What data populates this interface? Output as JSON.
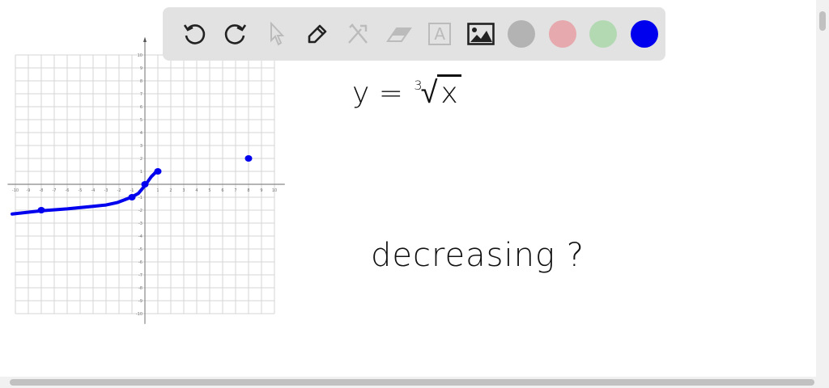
{
  "toolbar": {
    "tools": [
      {
        "name": "undo-icon",
        "enabled": true
      },
      {
        "name": "redo-icon",
        "enabled": true
      },
      {
        "name": "select-pointer-icon",
        "enabled": false
      },
      {
        "name": "pen-icon",
        "enabled": true
      },
      {
        "name": "tools-icon",
        "enabled": false
      },
      {
        "name": "eraser-icon",
        "enabled": false
      },
      {
        "name": "text-box-icon",
        "enabled": false
      },
      {
        "name": "image-icon",
        "enabled": true
      }
    ],
    "text_tool_glyph": "A",
    "colors": [
      "#b3b3b3",
      "#e6a9ad",
      "#b3d9b3",
      "#0000ee"
    ],
    "selected_color": "#0000ee"
  },
  "notes": {
    "equation_lhs": "y =",
    "equation_index": "3",
    "equation_radicand": "x",
    "question": "decreasing ?"
  },
  "chart_data": {
    "type": "line",
    "title": "",
    "xlim": [
      -10,
      10
    ],
    "ylim": [
      -10,
      10
    ],
    "grid": true,
    "x_ticks": [
      "-10",
      "-9",
      "-8",
      "-7",
      "-6",
      "-5",
      "-4",
      "-3",
      "-2",
      "-1",
      "1",
      "2",
      "3",
      "4",
      "5",
      "6",
      "7",
      "8",
      "9",
      "10"
    ],
    "y_ticks": [
      "10",
      "9",
      "8",
      "7",
      "6",
      "5",
      "4",
      "3",
      "2",
      "1",
      "-1",
      "-2",
      "-3",
      "-4",
      "-5",
      "-6",
      "-7",
      "-8",
      "-9",
      "-10"
    ],
    "series": [
      {
        "name": "hand-drawn curve",
        "color": "#0000ee",
        "x": [
          -10.25,
          -8,
          -6,
          -4,
          -3,
          -2.1,
          -1.05,
          -0.5,
          0,
          0.5,
          1
        ],
        "y": [
          -2.3,
          -2.05,
          -1.9,
          -1.7,
          -1.6,
          -1.4,
          -1.0,
          -0.7,
          -0.1,
          0.6,
          1.1
        ]
      }
    ],
    "points": [
      {
        "x": -8,
        "y": -2
      },
      {
        "x": -1,
        "y": -1
      },
      {
        "x": 0,
        "y": 0
      },
      {
        "x": 1,
        "y": 1
      },
      {
        "x": 8,
        "y": 2
      }
    ]
  }
}
